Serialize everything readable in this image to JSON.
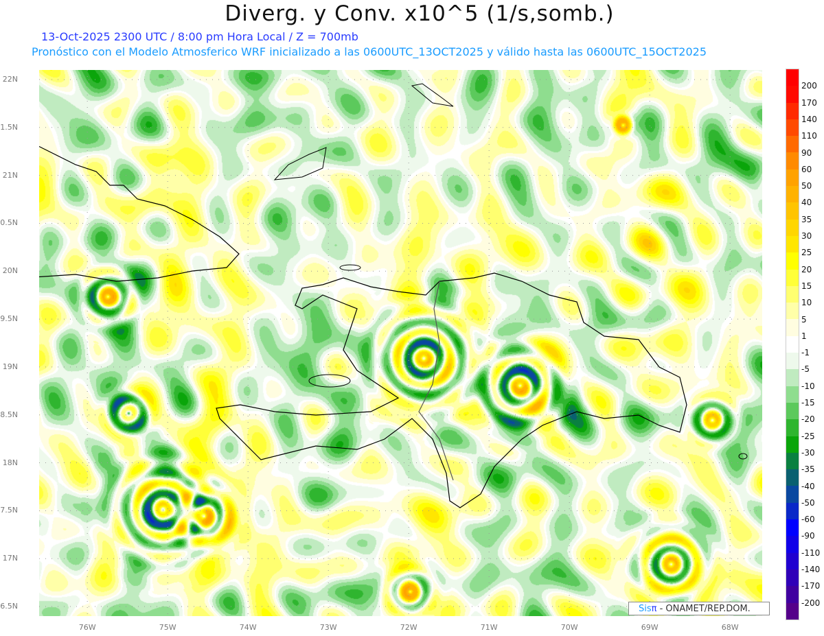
{
  "header": {
    "title": "Diverg. y Conv. x10^5 (1/s,somb.)",
    "subtitle1": "13-Oct-2025  2300 UTC / 8:00 pm Hora Local / Z = 700mb",
    "subtitle2": "Pronóstico con el Modelo Atmosferico WRF inicializado a las 0600UTC_13OCT2025 y válido hasta las  0600UTC_15OCT2025"
  },
  "chart_data": {
    "type": "heatmap",
    "title": "Diverg. y Conv. x10^5 (1/s,somb.)",
    "variable": "Divergence/Convergence x10^5 (1/s) at 700mb",
    "lat_ticks": [
      "22N",
      "1.5N",
      "21N",
      "0.5N",
      "20N",
      "9.5N",
      "19N",
      "8.5N",
      "18N",
      "7.5N",
      "17N",
      "6.5N"
    ],
    "lat_values": [
      22,
      21.5,
      21,
      20.5,
      20,
      19.5,
      19,
      18.5,
      18,
      17.5,
      17,
      16.5
    ],
    "lon_ticks": [
      "76W",
      "75W",
      "74W",
      "73W",
      "72W",
      "71W",
      "70W",
      "69W",
      "68W"
    ],
    "lon_values": [
      -76,
      -75,
      -74,
      -73,
      -72,
      -71,
      -70,
      -69,
      -68
    ],
    "xlim": [
      -76.6,
      -67.6
    ],
    "ylim": [
      16.4,
      22.1
    ],
    "grid": true,
    "colorbar": {
      "labels": [
        "200",
        "170",
        "140",
        "110",
        "90",
        "60",
        "50",
        "40",
        "35",
        "30",
        "25",
        "20",
        "15",
        "10",
        "5",
        "1",
        "-1",
        "-5",
        "-10",
        "-15",
        "-20",
        "-25",
        "-30",
        "-35",
        "-40",
        "-50",
        "-60",
        "-90",
        "-110",
        "-140",
        "-170",
        "-200"
      ],
      "colors": [
        "#ff0000",
        "#ff0a00",
        "#ff2a00",
        "#ff4a00",
        "#ff6a00",
        "#ff8a00",
        "#ffa200",
        "#ffb200",
        "#ffc400",
        "#ffd600",
        "#ffe600",
        "#ffff00",
        "#ffff38",
        "#ffff70",
        "#ffffa8",
        "#fffde0",
        "#ffffff",
        "#eef9ec",
        "#c0ebc0",
        "#8fdd8f",
        "#5cc95c",
        "#2fb52f",
        "#0aa50a",
        "#0a8040",
        "#0a6070",
        "#0a48a0",
        "#0a28c8",
        "#0000ff",
        "#1000e8",
        "#2000d0",
        "#3000b8",
        "#4000a0",
        "#55008a"
      ]
    },
    "features": [
      "Hispaniola",
      "Cuba (east)",
      "Turks and Caicos",
      "Bahamas (south)"
    ]
  },
  "footer": {
    "logo_sis": "Sis",
    "logo_pi": "π",
    "logo_text": " -  ONAMET/REP.DOM."
  }
}
